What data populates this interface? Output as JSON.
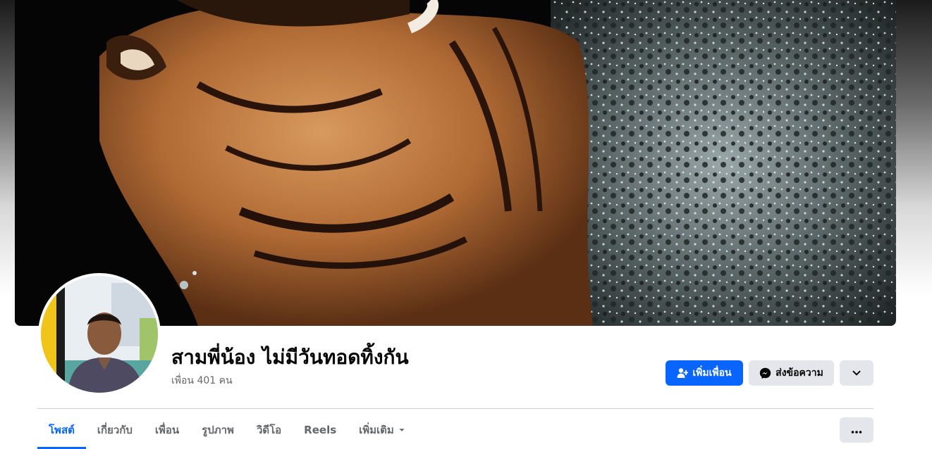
{
  "profile": {
    "name": "สามพี่น้อง ไม่มีวันทอดทิ้งกัน",
    "friends_text": "เพื่อน 401 คน",
    "cover_image": "tiger-splashing-water",
    "avatar_image": "man-portrait"
  },
  "actions": {
    "add_friend_label": "เพิ่มเพื่อน",
    "add_friend_icon": "add-friend-icon",
    "message_label": "ส่งข้อความ",
    "message_icon": "messenger-icon",
    "dropdown_icon": "chevron-down-icon"
  },
  "tabs": [
    {
      "label": "โพสต์",
      "active": true
    },
    {
      "label": "เกี่ยวกับ",
      "active": false
    },
    {
      "label": "เพื่อน",
      "active": false
    },
    {
      "label": "รูปภาพ",
      "active": false
    },
    {
      "label": "วิดีโอ",
      "active": false
    },
    {
      "label": "Reels",
      "active": false
    },
    {
      "label": "เพิ่มเติม",
      "active": false,
      "icon": "caret-down-icon"
    }
  ],
  "more_options_icon": "ellipsis-icon",
  "colors": {
    "accent": "#0866ff",
    "secondary_button": "#e4e6eb",
    "muted_text": "#65676b",
    "divider": "#ced0d4"
  }
}
